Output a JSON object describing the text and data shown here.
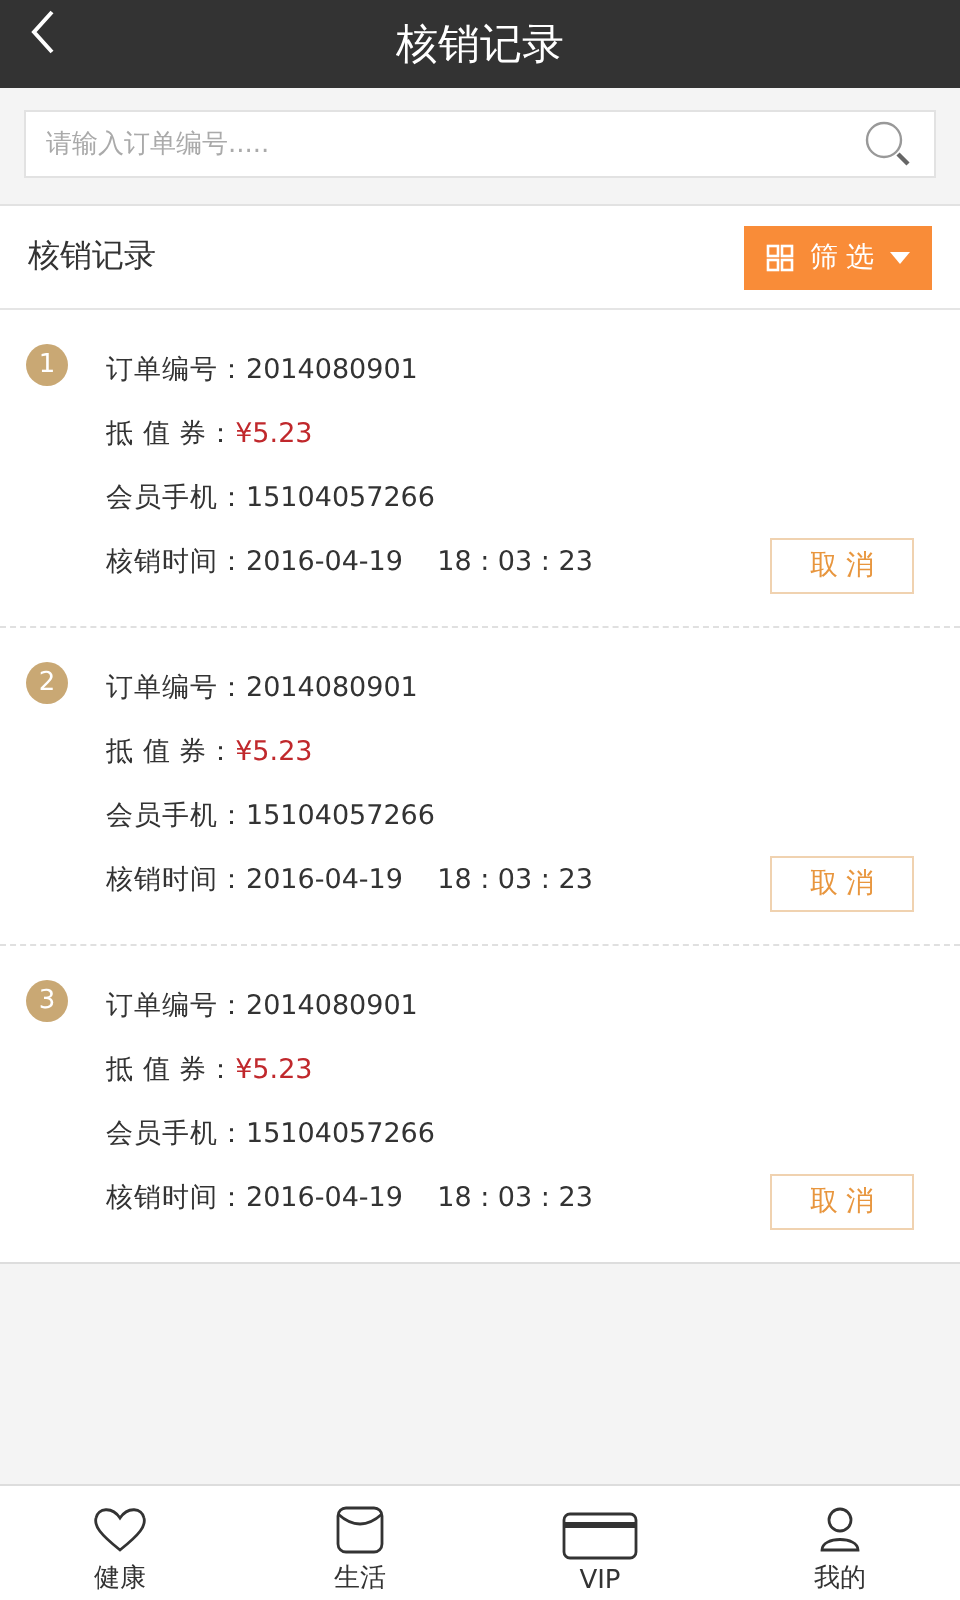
{
  "header": {
    "title": "核销记录"
  },
  "search": {
    "placeholder": "请输入订单编号....."
  },
  "section": {
    "title": "核销记录",
    "filter_button": "筛 选"
  },
  "records": [
    {
      "number": "1",
      "fields": [
        {
          "kind": "plain",
          "label": "订单编号：",
          "value": "2014080901"
        },
        {
          "kind": "price",
          "label": "抵 值 券：",
          "value": "¥5.23"
        },
        {
          "kind": "plain",
          "label": "会员手机：",
          "value": "15104057266"
        },
        {
          "kind": "plain",
          "label": "核销时间：",
          "value": "2016-04-19    18 : 03 : 23"
        }
      ],
      "cancel_button": "取 消"
    },
    {
      "number": "2",
      "fields": [
        {
          "kind": "plain",
          "label": "订单编号：",
          "value": "2014080901"
        },
        {
          "kind": "price",
          "label": "抵 值 券：",
          "value": "¥5.23"
        },
        {
          "kind": "plain",
          "label": "会员手机：",
          "value": "15104057266"
        },
        {
          "kind": "plain",
          "label": "核销时间：",
          "value": "2016-04-19    18 : 03 : 23"
        }
      ],
      "cancel_button": "取 消"
    },
    {
      "number": "3",
      "fields": [
        {
          "kind": "plain",
          "label": "订单编号：",
          "value": "2014080901"
        },
        {
          "kind": "price",
          "label": "抵 值 券：",
          "value": "¥5.23"
        },
        {
          "kind": "plain",
          "label": "会员手机：",
          "value": "15104057266"
        },
        {
          "kind": "plain",
          "label": "核销时间：",
          "value": "2016-04-19    18 : 03 : 23"
        }
      ],
      "cancel_button": "取 消"
    }
  ],
  "tab_bar": [
    {
      "kind": "heart",
      "label": "健康",
      "selected": false
    },
    {
      "kind": "bag",
      "label": "生活",
      "selected": false
    },
    {
      "kind": "card",
      "label": "VIP",
      "selected": false
    },
    {
      "kind": "person",
      "label": "我的",
      "selected": false
    }
  ]
}
